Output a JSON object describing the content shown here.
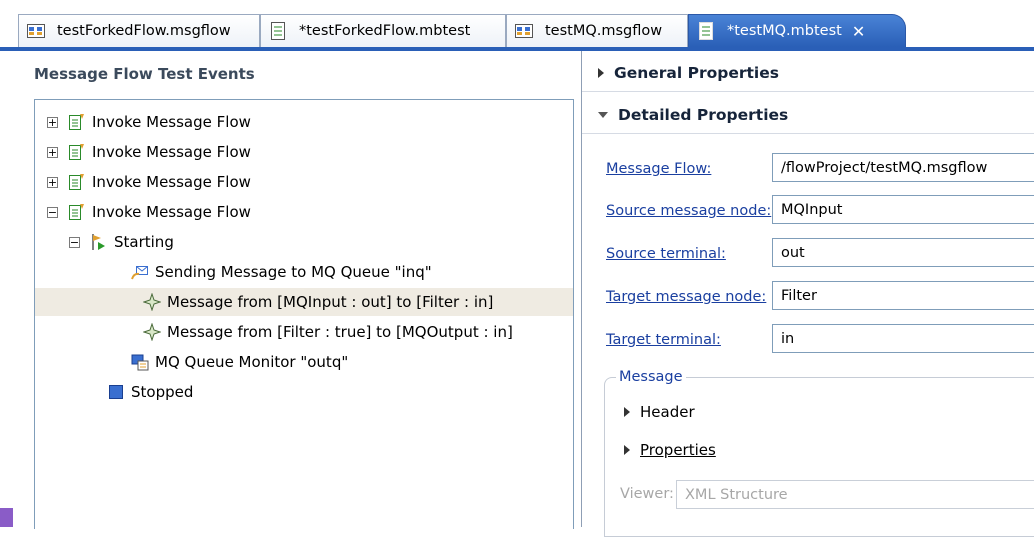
{
  "tabs": [
    {
      "label": "testForkedFlow.msgflow",
      "icon": "msgflow-icon"
    },
    {
      "label": "*testForkedFlow.mbtest",
      "icon": "mbtest-icon"
    },
    {
      "label": "testMQ.msgflow",
      "icon": "msgflow-icon"
    },
    {
      "label": "*testMQ.mbtest",
      "icon": "mbtest-icon",
      "close": "✕"
    }
  ],
  "left_panel": {
    "title": "Message Flow Test Events",
    "tree": [
      {
        "label": "Invoke Message Flow",
        "expander": "+"
      },
      {
        "label": "Invoke Message Flow",
        "expander": "+"
      },
      {
        "label": "Invoke Message Flow",
        "expander": "+"
      },
      {
        "label": "Invoke Message Flow",
        "expander": "−"
      },
      {
        "label": "Starting",
        "expander": "−"
      },
      {
        "label": "Sending Message to MQ Queue \"inq\""
      },
      {
        "label": "Message from [MQInput : out] to [Filter : in]"
      },
      {
        "label": "Message from [Filter : true] to [MQOutput : in]"
      },
      {
        "label": "MQ Queue Monitor \"outq\""
      },
      {
        "label": "Stopped"
      }
    ]
  },
  "right_panel": {
    "general_properties": "General Properties",
    "detailed_properties": "Detailed Properties",
    "properties": [
      {
        "label": "Message Flow:",
        "value": "/flowProject/testMQ.msgflow"
      },
      {
        "label": "Source message node:",
        "value": "MQInput"
      },
      {
        "label": "Source terminal:",
        "value": "out"
      },
      {
        "label": "Target message node:",
        "value": "Filter"
      },
      {
        "label": "Target terminal:",
        "value": "in"
      }
    ],
    "message_group": {
      "label": "Message",
      "header": "Header",
      "properties": "Properties",
      "viewer_label": "Viewer:",
      "viewer_value": "XML Structure"
    }
  },
  "colors": {
    "accent": "#2a5fb7",
    "link": "#1a3fa0",
    "selection": "#efebe2"
  }
}
